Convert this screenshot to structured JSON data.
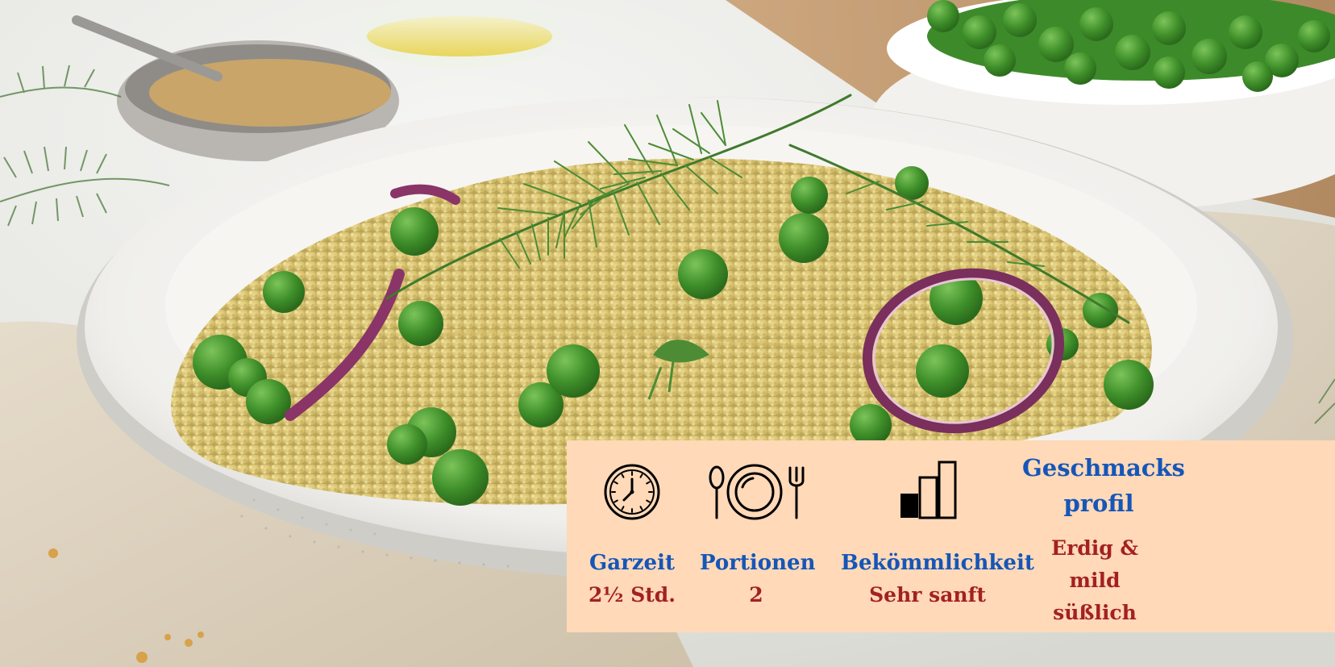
{
  "info_panel": {
    "background": "#ffd9b8",
    "label_color": "#1556b8",
    "value_color": "#a32121",
    "cook_time": {
      "icon": "clock-icon",
      "label": "Garzeit",
      "value": "2½ Std."
    },
    "servings": {
      "icon": "plate-cutlery-icon",
      "label": "Portionen",
      "value": "2"
    },
    "digestibility": {
      "icon": "level-bars-icon",
      "label": "Bekömmlichkeit",
      "value": "Sehr sanft"
    },
    "taste_profile": {
      "heading_line1": "Geschmacks",
      "heading_line2": "profil",
      "value_line1": "Erdig &",
      "value_line2": "mild",
      "value_line3": "süßlich"
    }
  }
}
